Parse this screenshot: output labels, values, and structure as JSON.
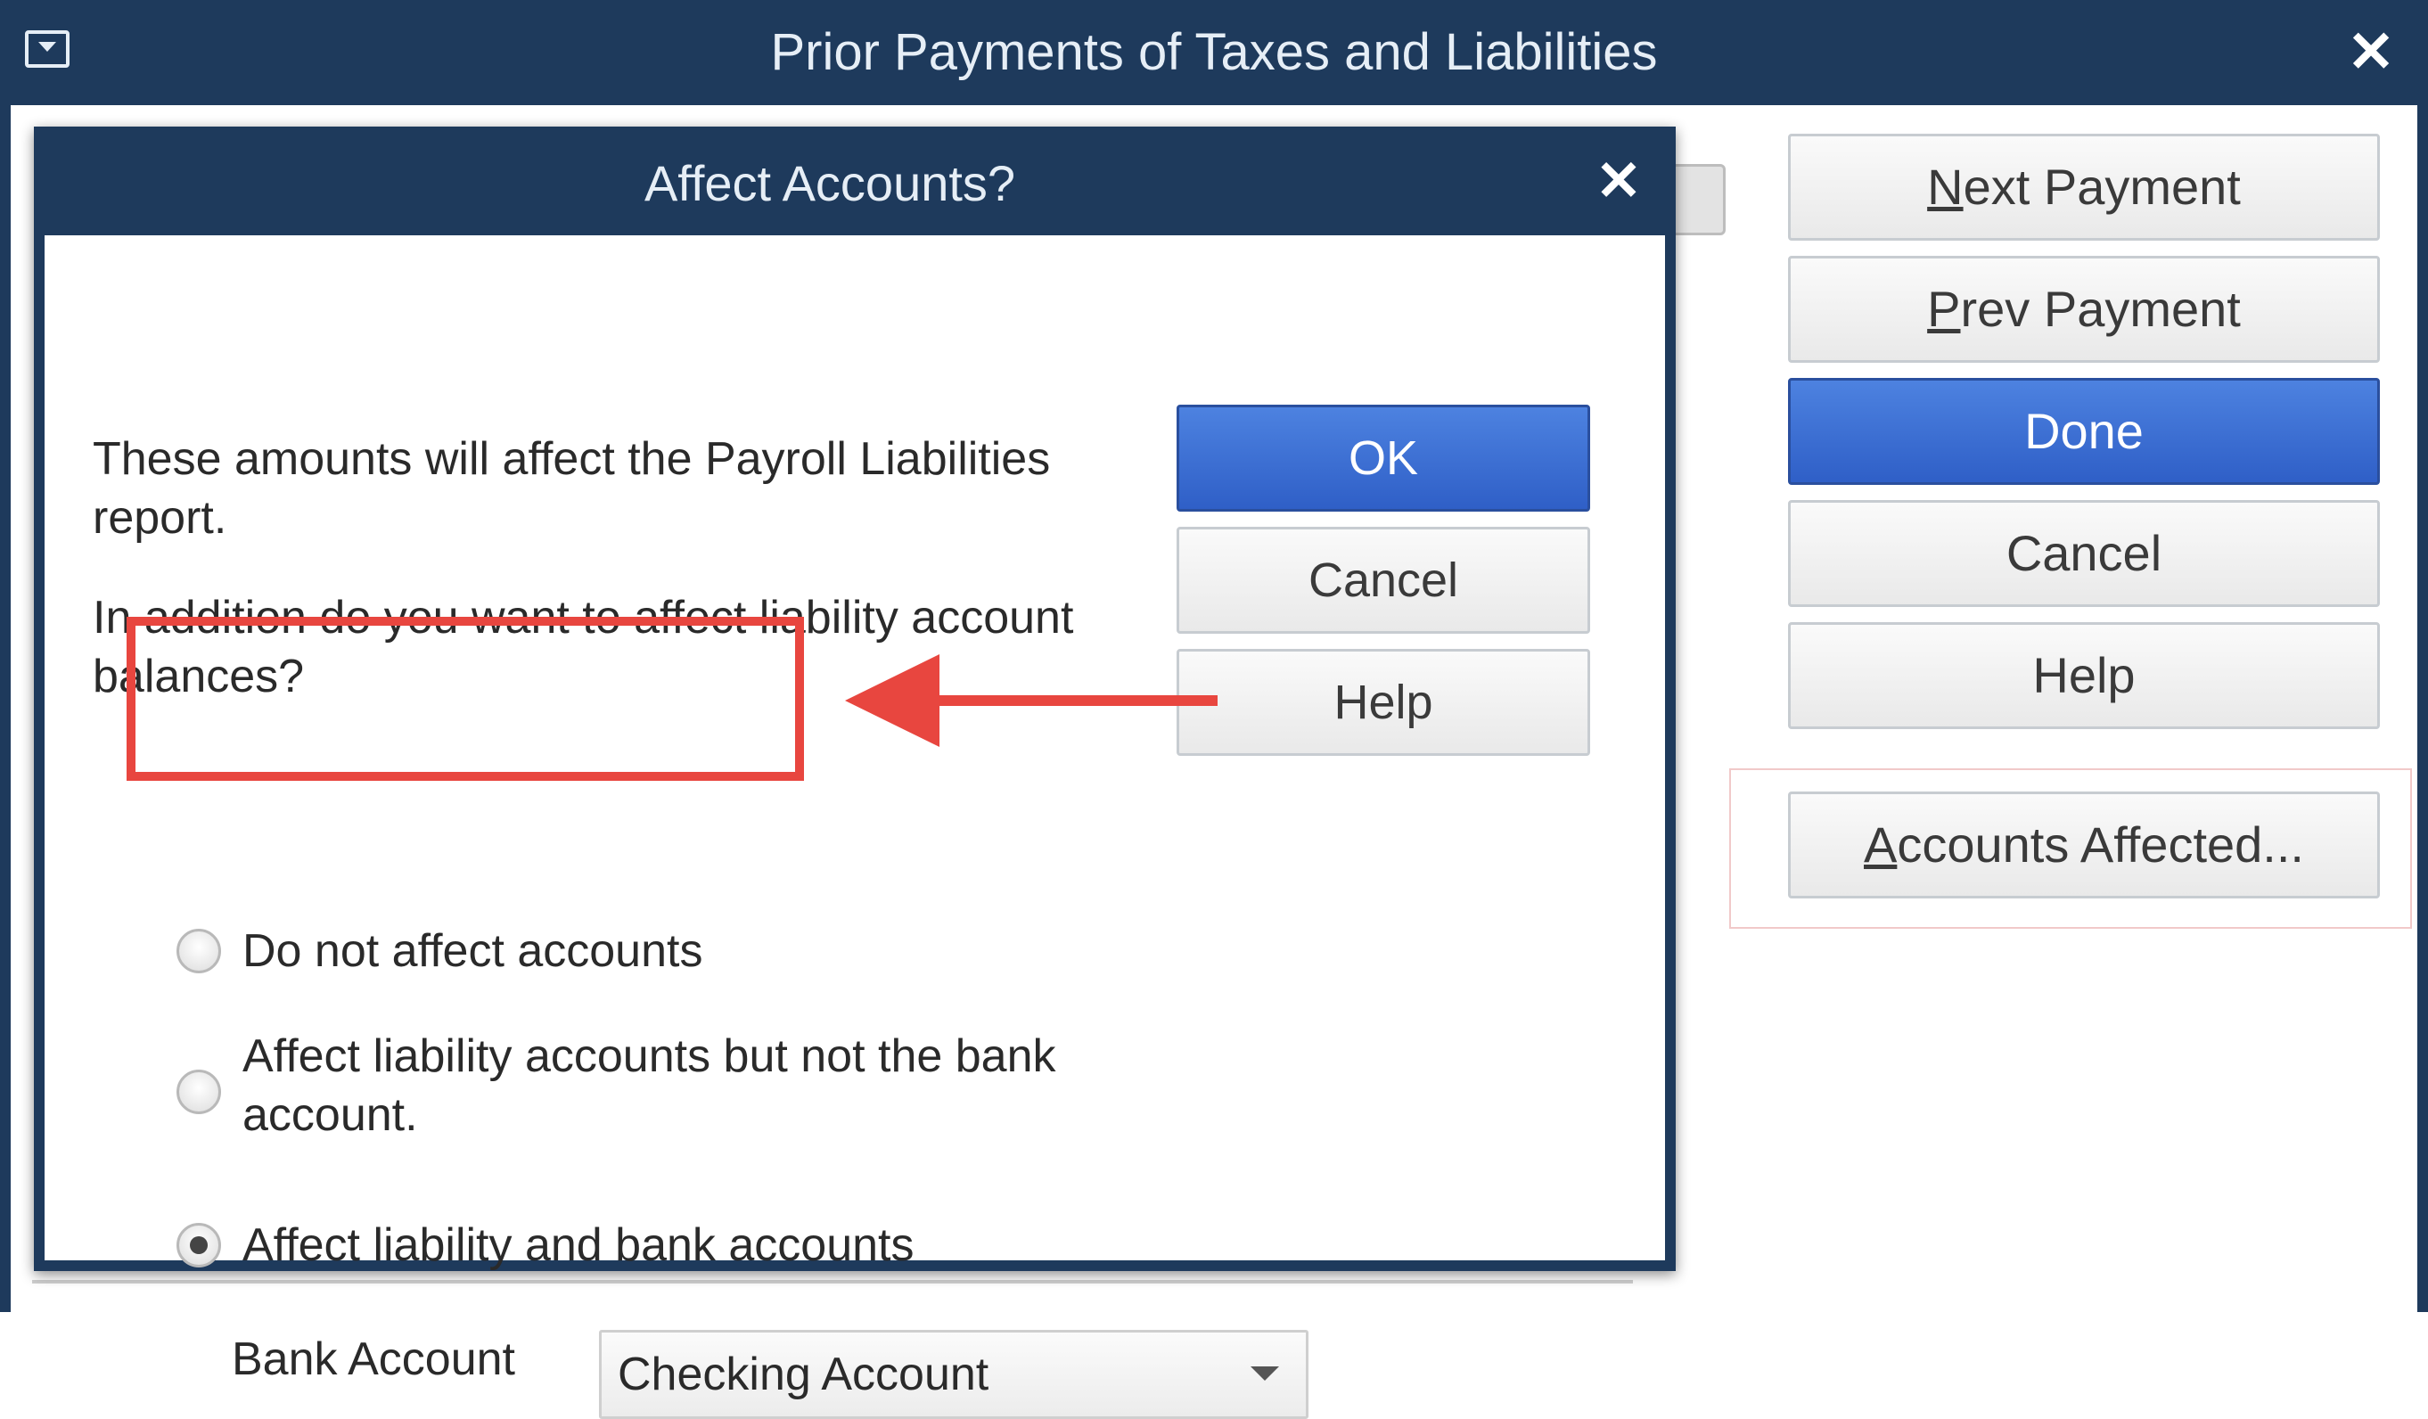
{
  "outer_window": {
    "title": "Prior Payments of Taxes and Liabilities",
    "buttons": {
      "next_payment": {
        "mnemonic": "N",
        "rest": "ext Payment"
      },
      "prev_payment": {
        "mnemonic": "P",
        "rest": "rev Payment"
      },
      "done": "Done",
      "cancel": "Cancel",
      "help": "Help",
      "accounts_affected": {
        "mnemonic": "A",
        "rest": "ccounts Affected..."
      }
    }
  },
  "dialog": {
    "title": "Affect Accounts?",
    "message_1": "These amounts will affect the Payroll Liabilities report.",
    "message_2": "In addition do you want to affect liability account balances?",
    "buttons": {
      "ok": "OK",
      "cancel": "Cancel",
      "help": "Help"
    },
    "options": [
      {
        "label": "Do not affect accounts",
        "checked": false
      },
      {
        "label": "Affect liability accounts but not the bank account.",
        "checked": false
      },
      {
        "label": "Affect liability and bank accounts",
        "checked": true
      }
    ],
    "bank_account_label": "Bank Account",
    "bank_account_value": "Checking Account"
  },
  "colors": {
    "titlebar": "#1e3a5c",
    "primary_button": "#3a6fd8",
    "annotation": "#e8463f"
  }
}
